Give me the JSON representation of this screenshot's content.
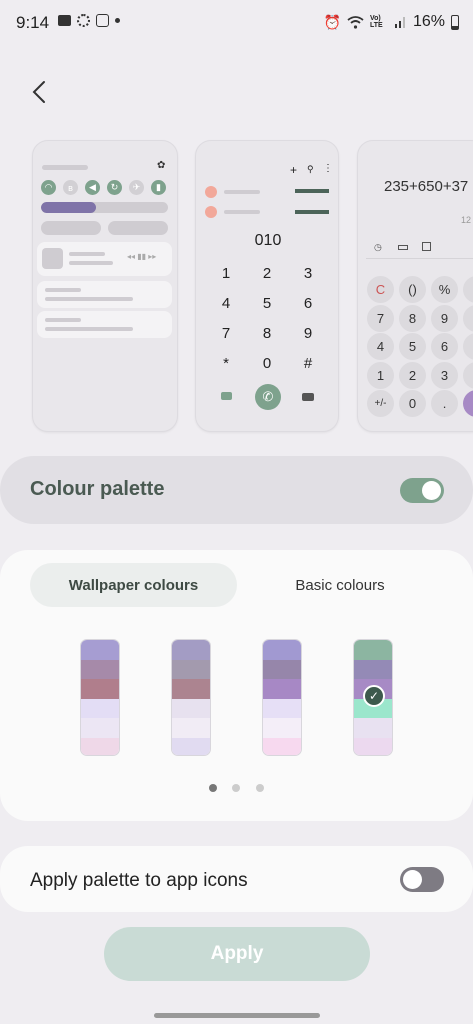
{
  "status_bar": {
    "time": "9:14",
    "battery": "16%",
    "network_label": "Vo) LTE"
  },
  "preview": {
    "dialer_number": "010",
    "dialer_keys": [
      "1",
      "2",
      "3",
      "4",
      "5",
      "6",
      "7",
      "8",
      "9",
      "*",
      "0",
      "#"
    ],
    "calc_expression": "235+650+37",
    "calc_result": "12",
    "calc_keys": [
      "C",
      "()",
      "%",
      "7",
      "8",
      "9",
      "4",
      "5",
      "6",
      "1",
      "2",
      "3",
      "+/-",
      "0",
      "."
    ]
  },
  "colour_palette": {
    "label": "Colour palette",
    "enabled": true
  },
  "palette_tabs": {
    "wallpaper": "Wallpaper colours",
    "basic": "Basic colours",
    "active": "wallpaper"
  },
  "swatches": [
    {
      "colors": [
        "#a69dd2",
        "#a68aa9",
        "#b07e8c",
        "#e3ddf5",
        "#ece6f4",
        "#efd8e8"
      ],
      "selected": false
    },
    {
      "colors": [
        "#a39cc4",
        "#a39aae",
        "#ac8490",
        "#e7e1ef",
        "#f1ecf5",
        "#e1dbf1"
      ],
      "selected": false
    },
    {
      "colors": [
        "#a199d1",
        "#9686aa",
        "#a788c5",
        "#e6dff6",
        "#f4eef8",
        "#f7d9ef"
      ],
      "selected": false
    },
    {
      "colors": [
        "#8cb5a1",
        "#948ab6",
        "#a78ac5",
        "#9be6cc",
        "#e8e1f1",
        "#ecd9ef"
      ],
      "selected": true
    }
  ],
  "page_indicator": {
    "count": 3,
    "current": 0
  },
  "apply_icons": {
    "label": "Apply palette to app icons",
    "enabled": false
  },
  "apply_button": {
    "label": "Apply"
  },
  "colors": {
    "accent": "#7ea28d",
    "toggle_off": "#7e7b83",
    "apply_disabled": "#c9dbd5"
  }
}
